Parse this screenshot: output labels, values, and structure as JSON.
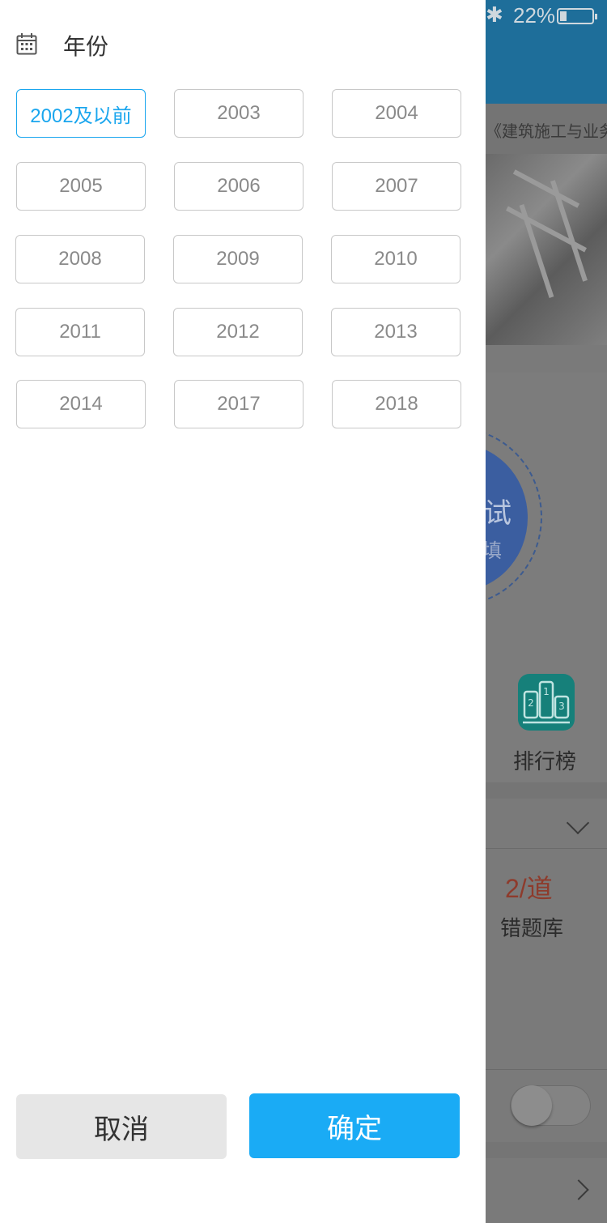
{
  "status_bar": {
    "battery_percent": "22%",
    "battery_level": 0.22,
    "bluetooth_icon": "bluetooth-icon"
  },
  "background": {
    "banner_text": "《建筑施工与业务",
    "circle_text_1": "试",
    "circle_text_2": "填",
    "ranking_label": "排行榜",
    "wrong_count": "2/道",
    "wrong_label": "错题库"
  },
  "drawer": {
    "title": "年份",
    "title_icon": "calendar-icon",
    "years": [
      {
        "label": "2002及以前",
        "selected": true
      },
      {
        "label": "2003",
        "selected": false
      },
      {
        "label": "2004",
        "selected": false
      },
      {
        "label": "2005",
        "selected": false
      },
      {
        "label": "2006",
        "selected": false
      },
      {
        "label": "2007",
        "selected": false
      },
      {
        "label": "2008",
        "selected": false
      },
      {
        "label": "2009",
        "selected": false
      },
      {
        "label": "2010",
        "selected": false
      },
      {
        "label": "2011",
        "selected": false
      },
      {
        "label": "2012",
        "selected": false
      },
      {
        "label": "2013",
        "selected": false
      },
      {
        "label": "2014",
        "selected": false
      },
      {
        "label": "2017",
        "selected": false
      },
      {
        "label": "2018",
        "selected": false
      }
    ],
    "cancel_label": "取消",
    "confirm_label": "确定"
  },
  "colors": {
    "accent": "#1aabf5",
    "selected_border": "#1aa6ee",
    "header": "#1e6e9a",
    "overlay": "#7a7a7a"
  }
}
